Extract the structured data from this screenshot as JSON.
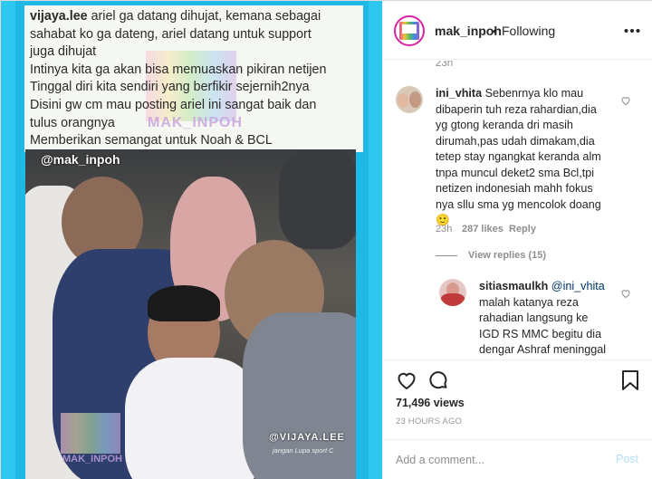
{
  "media": {
    "caption_username": "vijaya.lee",
    "caption_body": " ariel ga datang dihujat, kemana sebagai\nsahabat ko ga dateng, ariel datang untuk support\njuga dihujat\nIntinya kita ga akan bisa memuaskan pikiran netijen\nTinggal diri kita sendiri yang berfikir sejernih2nya\nDisini gw cm mau posting ariel ini sangat baik dan\ntulus orangnya\nMemberikan semangat untuk Noah & BCL",
    "watermark_top": "MAK_INPOH",
    "photo_handle": "@mak_inpoh",
    "photo_handle_right": "@VIJAYA.LEE",
    "photo_sub": "jangan Lupa sport C",
    "photo_watermark": "MAK_INPOH"
  },
  "header": {
    "username": "mak_inpoh",
    "dot": "•",
    "following": "Following",
    "more_icon": "more-horizontal-icon"
  },
  "comments": {
    "top_time": "23h",
    "c1": {
      "username": "ini_vhita",
      "text": " Sebenrnya klo mau\ndibaperin tuh reza rahardian,dia\nyg gtong keranda dri masih\ndirumah,pas udah dimakam,dia\ntetep stay ngangkat keranda alm\ntnpa muncul deket2 sma Bcl,tpi\nnetizen indonesiah mahh fokus\nnya sllu sma yg mencolok doang\n🙂",
      "time": "23h",
      "likes": "287 likes",
      "reply": "Reply"
    },
    "view_replies": "View replies (15)",
    "c2": {
      "username": "sitiasmaulkh",
      "mention": "@ini_vhita",
      "text": "malah katanya reza\nrahadian langsung ke\nIGD RS MMC begitu dia\ndengar Ashraf meninggal"
    }
  },
  "actions": {
    "views": "71,496 views",
    "ago": "23 HOURS AGO"
  },
  "add_comment": {
    "placeholder": "Add a comment...",
    "post": "Post"
  }
}
